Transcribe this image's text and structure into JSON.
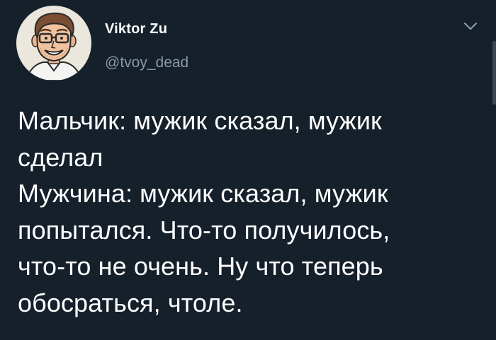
{
  "author": {
    "display_name": "Viktor Zu",
    "handle": "@tvoy_dead"
  },
  "icons": {
    "avatar": "cartoon-man-with-glasses-avatar",
    "menu": "chevron-down-icon"
  },
  "tweet": {
    "lines": [
      "Мальчик: мужик сказал, мужик",
      "сделал",
      "Мужчина: мужик сказал, мужик",
      "попытался. Что-то получилось,",
      "что-то не очень. Ну что теперь",
      "обосраться, чтоле."
    ]
  },
  "colors": {
    "background": "#15202b",
    "text": "#ffffff",
    "secondary_text": "#8899a6"
  }
}
